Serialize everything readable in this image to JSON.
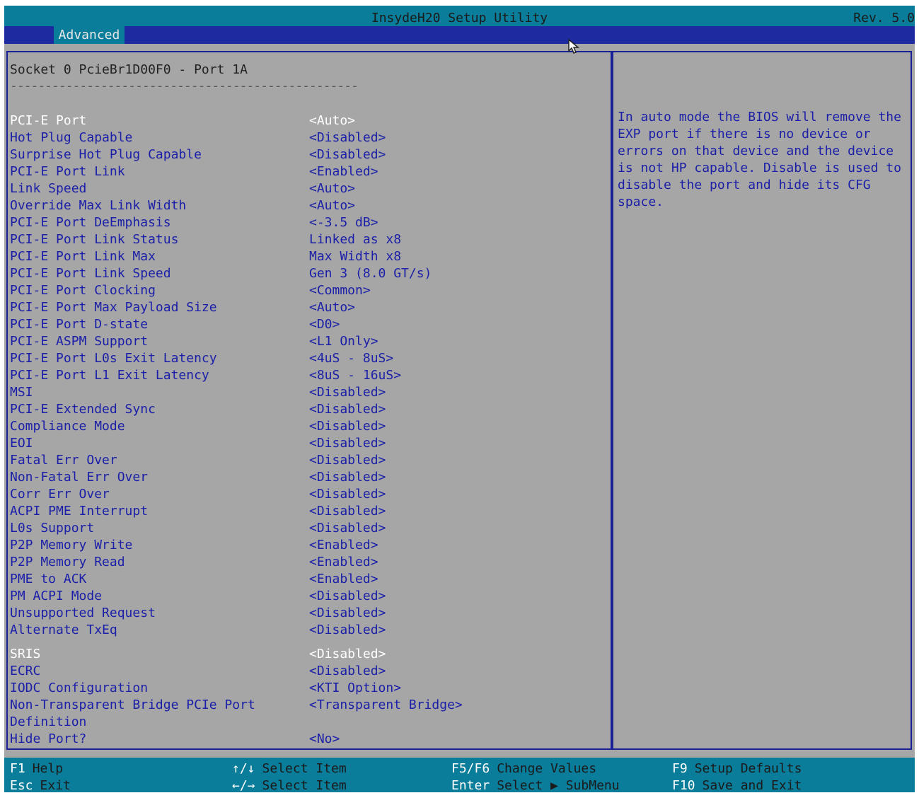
{
  "title": "InsydeH20 Setup Utility",
  "revision": "Rev. 5.0",
  "active_tab": "Advanced",
  "page": {
    "heading": "Socket 0 PcieBr1D00F0 - Port 1A",
    "separator": "--------------------------------------------------"
  },
  "settings": [
    {
      "label": "PCI-E Port",
      "value": "<Auto>",
      "selected": true
    },
    {
      "label": "Hot Plug Capable",
      "value": "<Disabled>"
    },
    {
      "label": "Surprise Hot Plug Capable",
      "value": "<Disabled>"
    },
    {
      "label": "PCI-E Port Link",
      "value": "<Enabled>"
    },
    {
      "label": "Link Speed",
      "value": "<Auto>"
    },
    {
      "label": "Override Max Link Width",
      "value": "<Auto>"
    },
    {
      "label": "PCI-E Port DeEmphasis",
      "value": "<-3.5 dB>"
    },
    {
      "label": "PCI-E Port Link Status",
      "value": "Linked as x8"
    },
    {
      "label": "PCI-E Port Link Max",
      "value": "Max Width x8"
    },
    {
      "label": "PCI-E Port Link Speed",
      "value": "Gen 3 (8.0 GT/s)"
    },
    {
      "label": "PCI-E Port Clocking",
      "value": "<Common>"
    },
    {
      "label": "PCI-E Port Max Payload Size",
      "value": "<Auto>"
    },
    {
      "label": "PCI-E Port D-state",
      "value": "<D0>"
    },
    {
      "label": "PCI-E ASPM Support",
      "value": "<L1 Only>"
    },
    {
      "label": "PCI-E Port L0s Exit Latency",
      "value": "<4uS - 8uS>"
    },
    {
      "label": "PCI-E Port L1 Exit Latency",
      "value": "<8uS - 16uS>"
    },
    {
      "label": "MSI",
      "value": "<Disabled>"
    },
    {
      "label": "PCI-E Extended Sync",
      "value": "<Disabled>"
    },
    {
      "label": "Compliance Mode",
      "value": "<Disabled>"
    },
    {
      "label": "EOI",
      "value": "<Disabled>"
    },
    {
      "label": "Fatal Err Over",
      "value": "<Disabled>"
    },
    {
      "label": "Non-Fatal Err Over",
      "value": "<Disabled>"
    },
    {
      "label": "Corr Err Over",
      "value": "<Disabled>"
    },
    {
      "label": "ACPI PME Interrupt",
      "value": "<Disabled>"
    },
    {
      "label": "L0s Support",
      "value": "<Disabled>"
    },
    {
      "label": "P2P Memory Write",
      "value": "<Enabled>"
    },
    {
      "label": "P2P Memory Read",
      "value": "<Enabled>"
    },
    {
      "label": "PME to ACK",
      "value": "<Enabled>"
    },
    {
      "label": "PM ACPI Mode",
      "value": "<Disabled>"
    },
    {
      "label": "Unsupported Request",
      "value": "<Disabled>"
    },
    {
      "label": "Alternate TxEq",
      "value": "<Disabled>"
    },
    {
      "label": "SRIS",
      "value": "<Disabled>",
      "highlight": true
    },
    {
      "label": "ECRC",
      "value": "<Disabled>"
    },
    {
      "label": "IODC Configuration",
      "value": "<KTI Option>"
    },
    {
      "label": "Non-Transparent Bridge PCIe Port",
      "value": "<Transparent Bridge>"
    },
    {
      "label": "Definition",
      "value": ""
    },
    {
      "label": "Hide Port?",
      "value": "<No>"
    }
  ],
  "help_text": "In auto mode the BIOS will remove the EXP port if there is no device or errors on that device and the device is not HP capable.  Disable is used to disable the port and hide its CFG space.",
  "footer": [
    {
      "key": "F1",
      "desc": "Help"
    },
    {
      "key": "Esc",
      "desc": "Exit"
    },
    {
      "key": "↑/↓",
      "desc": "Select Item"
    },
    {
      "key": "←/→",
      "desc": "Select Item"
    },
    {
      "key": "F5/F6",
      "desc": "Change Values"
    },
    {
      "key": "Enter",
      "desc": "Select ▶ SubMenu"
    },
    {
      "key": "F9",
      "desc": "Setup Defaults"
    },
    {
      "key": "F10",
      "desc": "Save and Exit"
    }
  ],
  "colors": {
    "background": "#a6a6a6",
    "titlebar": "#0a7d9a",
    "tabbar": "#1e2aa0",
    "text": "#1b1fa8",
    "selected_text": "#ffffff",
    "border": "#1a2096"
  }
}
